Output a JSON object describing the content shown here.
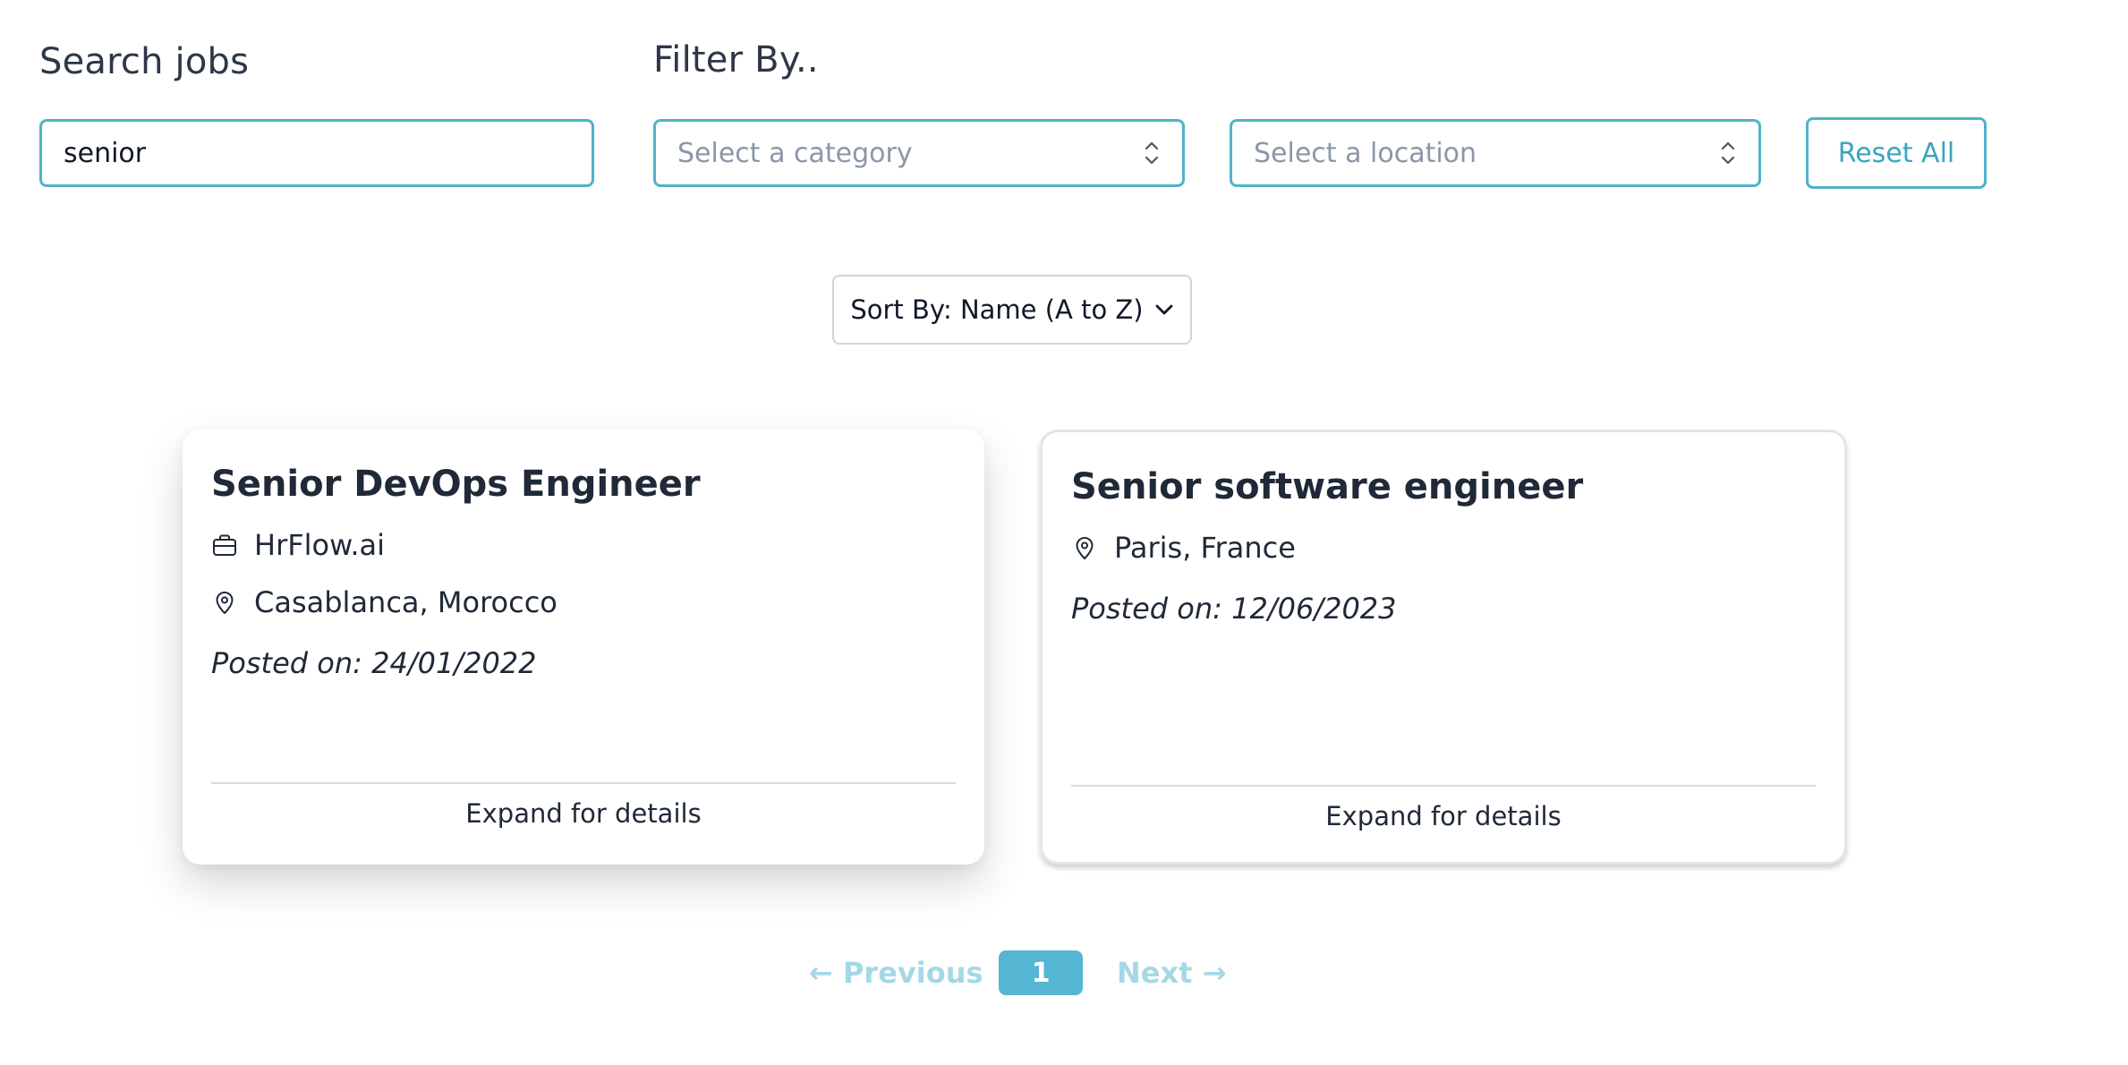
{
  "search": {
    "label": "Search jobs",
    "value": "senior"
  },
  "filter": {
    "label": "Filter By..",
    "category_placeholder": "Select a category",
    "location_placeholder": "Select a location",
    "reset_label": "Reset All"
  },
  "sort": {
    "label": "Sort By: Name (A to Z)"
  },
  "jobs": [
    {
      "title": "Senior DevOps Engineer",
      "company": "HrFlow.ai",
      "location": "Casablanca, Morocco",
      "posted": "Posted on: 24/01/2022",
      "expand": "Expand for details"
    },
    {
      "title": "Senior software engineer",
      "location": "Paris, France",
      "posted": "Posted on: 12/06/2023",
      "expand": "Expand for details"
    }
  ],
  "pagination": {
    "previous": "← Previous",
    "current": "1",
    "next": "Next →"
  },
  "icons": {
    "company": "briefcase-icon",
    "location": "map-pin-icon",
    "select": "chevron-up-down-icon",
    "sort": "chevron-down-icon"
  },
  "colors": {
    "accent": "#4fb3c8",
    "page_active": "#55b6d3",
    "page_inactive": "#a5d8e6"
  }
}
